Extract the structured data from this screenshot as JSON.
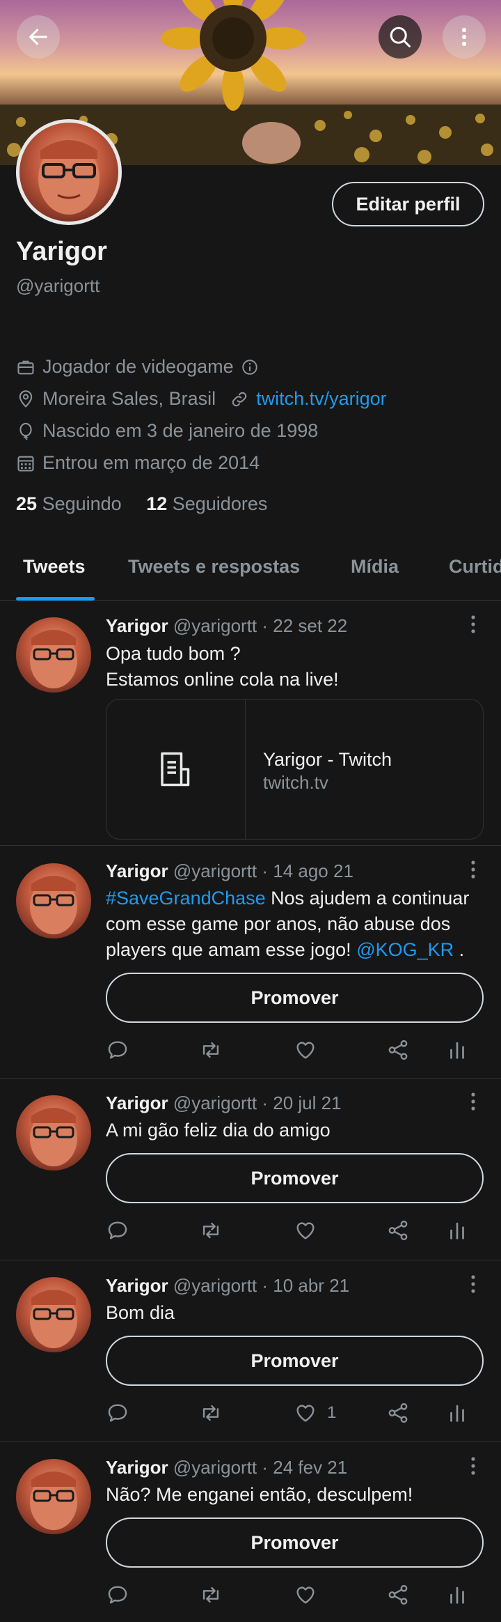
{
  "header": {
    "back_icon": "arrow-left-icon",
    "search_icon": "search-icon",
    "more_icon": "more-vertical-icon"
  },
  "profile": {
    "edit_label": "Editar perfil",
    "name": "Yarigor",
    "handle": "@yarigortt",
    "bio": "Jogador de videogame",
    "location": "Moreira Sales, Brasil",
    "website": "twitch.tv/yarigor",
    "birthday": "Nascido em 3 de janeiro de 1998",
    "joined": "Entrou em março de 2014",
    "following_count": "25",
    "following_label": "Seguindo",
    "followers_count": "12",
    "followers_label": "Seguidores"
  },
  "tabs": [
    {
      "label": "Tweets"
    },
    {
      "label": "Tweets e respostas"
    },
    {
      "label": "Mídia"
    },
    {
      "label": "Curtidas"
    }
  ],
  "tweets": [
    {
      "name": "Yarigor",
      "meta": "@yarigortt · 22 set 22",
      "line1": "Opa tudo bom ?",
      "line2": "Estamos online cola na live!",
      "card_title": "Yarigor - Twitch",
      "card_domain": "twitch.tv"
    },
    {
      "name": "Yarigor",
      "meta": "@yarigortt · 14 ago 21",
      "hashtag": "#SaveGrandChase",
      "text_a": " Nos ajudem a continuar com esse game por anos, não abuse dos players que amam esse jogo! ",
      "mention": "@KOG_KR",
      "text_b": " .",
      "promote_label": "Promover"
    },
    {
      "name": "Yarigor",
      "meta": "@yarigortt · 20 jul 21",
      "text": "A mi gão feliz dia do amigo",
      "promote_label": "Promover"
    },
    {
      "name": "Yarigor",
      "meta": "@yarigortt · 10 abr 21",
      "text": "Bom dia",
      "promote_label": "Promover",
      "like_count": "1"
    },
    {
      "name": "Yarigor",
      "meta": "@yarigortt · 24 fev 21",
      "text": "Não? Me enganei então, desculpem!",
      "promote_label": "Promover"
    }
  ],
  "colors": {
    "background": "#161616",
    "accent": "#1d9bf0",
    "text": "#e7e9ea",
    "muted": "#8b9399",
    "divider": "#2f3336"
  }
}
